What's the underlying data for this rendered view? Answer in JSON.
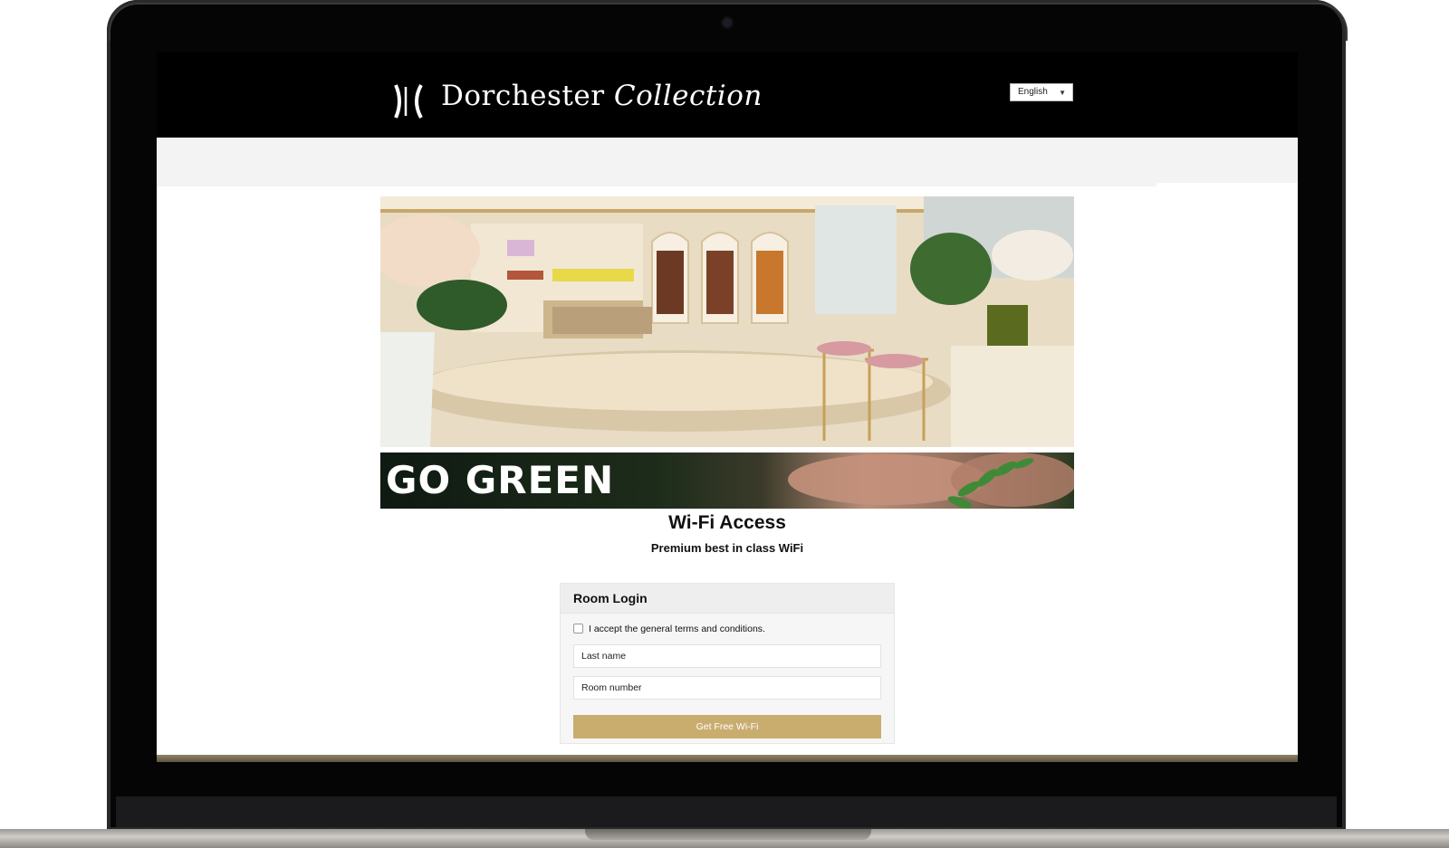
{
  "header": {
    "brand_primary": "Dorchester",
    "brand_secondary": "Collection",
    "language_selected": "English"
  },
  "banner": {
    "text": "GO GREEN"
  },
  "main": {
    "title": "Wi-Fi Access",
    "subtitle": "Premium best in class WiFi"
  },
  "login": {
    "title": "Room Login",
    "terms_label": "I accept the general terms and conditions.",
    "last_name_placeholder": "Last name",
    "room_number_placeholder": "Room number",
    "submit_label": "Get Free Wi-Fi"
  },
  "colors": {
    "accent_gold": "#c9ad6f",
    "header_bg": "#000000"
  },
  "icons": {
    "logo": "dorchester-logo-icon",
    "camera": "camera-icon",
    "caret": "chevron-down-icon"
  }
}
